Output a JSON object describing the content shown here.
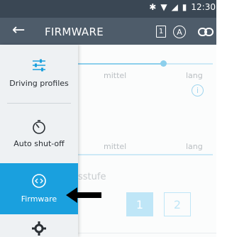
{
  "status_bar": {
    "time": "12:30",
    "icons": [
      "bluetooth-icon",
      "wifi-icon",
      "signal-icon",
      "battery-icon"
    ]
  },
  "app_bar": {
    "back_icon": "arrow-left-icon",
    "title": "FIRMWARE",
    "action_1_label": "1",
    "action_a_label": "A",
    "action_link_icon": "link-icon"
  },
  "drawer": {
    "items": [
      {
        "label": "Driving profiles",
        "icon": "sliders-icon",
        "selected": false
      },
      {
        "label": "Auto shut-off",
        "icon": "timer-icon",
        "selected": false
      },
      {
        "label": "Firmware",
        "icon": "code-icon",
        "selected": true
      },
      {
        "label": "",
        "icon": "gear-icon",
        "selected": false
      }
    ]
  },
  "content": {
    "slider1": {
      "label_mid": "mittel",
      "label_long": "lang",
      "value_fraction": 0.63
    },
    "slider2": {
      "label_mid": "mittel",
      "label_long": "lang"
    },
    "info_icon": "info-icon",
    "level_label": "sstufe",
    "levels": [
      "1",
      "2"
    ],
    "selected_level": "1"
  },
  "annotation": {
    "arrow_icon": "arrow-left-icon"
  },
  "colors": {
    "status_bar": "#3a4754",
    "app_bar": "#4e5c6a",
    "accent": "#1aa0de",
    "drawer_bg": "#eef1f3"
  }
}
